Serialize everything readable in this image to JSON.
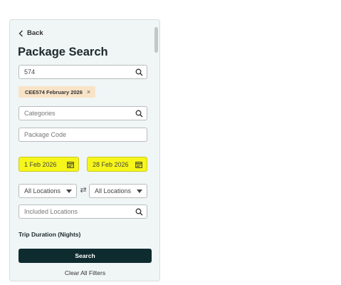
{
  "nav": {
    "back_label": "Back"
  },
  "page": {
    "title": "Package Search"
  },
  "search": {
    "value": "574"
  },
  "chips": [
    {
      "label": "CEE574 February 2026"
    }
  ],
  "categories": {
    "placeholder": "Categories"
  },
  "package_code": {
    "placeholder": "Package Code"
  },
  "dates": {
    "start": "1 Feb 2026",
    "end": "28 Feb 2026"
  },
  "locations": {
    "from": "All Locations",
    "to": "All Locations"
  },
  "included_locations": {
    "placeholder": "Included Locations"
  },
  "trip_duration": {
    "label": "Trip Duration (Nights)"
  },
  "actions": {
    "search_label": "Search",
    "clear_label": "Clear All Filters"
  },
  "icons": {
    "back": "chevron-left-icon",
    "search": "search-icon",
    "calendar": "calendar-icon",
    "swap": "swap-icon",
    "dropdown": "caret-down-icon",
    "chip_remove": "close-icon"
  },
  "colors": {
    "highlight": "#f6f61a",
    "chip_bg": "#f9e3c8",
    "primary_button": "#0e2b2f",
    "panel_bg": "#f0f5f5"
  }
}
